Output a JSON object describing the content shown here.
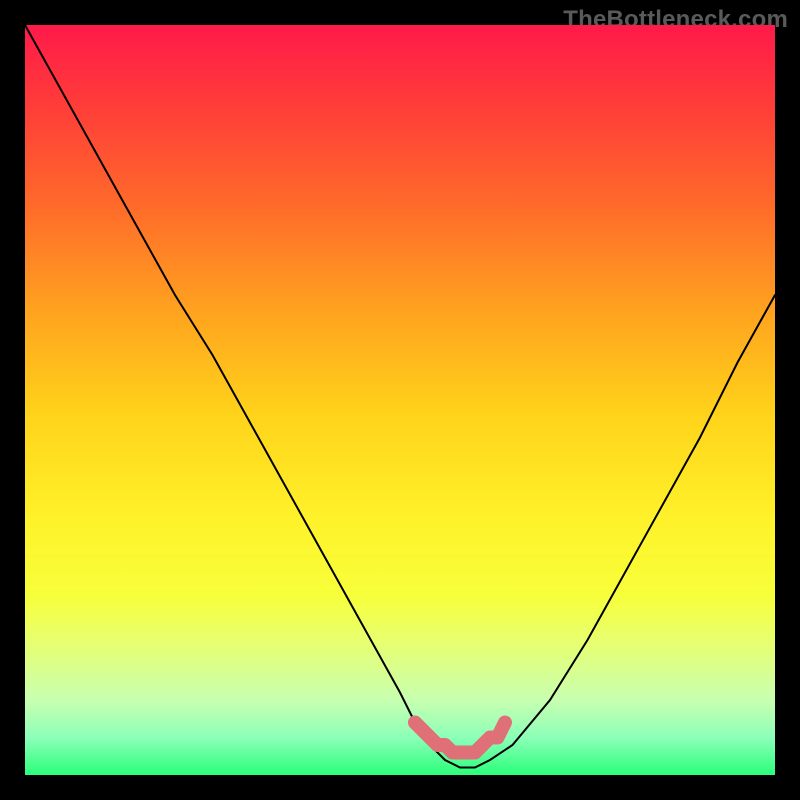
{
  "watermark": "TheBottleneck.com",
  "chart_data": {
    "type": "line",
    "title": "",
    "xlabel": "",
    "ylabel": "",
    "xlim": [
      0,
      100
    ],
    "ylim": [
      0,
      100
    ],
    "series": [
      {
        "name": "bottleneck-curve",
        "x": [
          0,
          5,
          10,
          15,
          20,
          25,
          30,
          35,
          40,
          45,
          50,
          52,
          54,
          56,
          58,
          60,
          62,
          65,
          70,
          75,
          80,
          85,
          90,
          95,
          100
        ],
        "y": [
          100,
          91,
          82,
          73,
          64,
          56,
          47,
          38,
          29,
          20,
          11,
          7,
          4,
          2,
          1,
          1,
          2,
          4,
          10,
          18,
          27,
          36,
          45,
          55,
          64
        ]
      }
    ],
    "annotations": [
      {
        "name": "optimal-marker",
        "kind": "points",
        "color": "#e07078",
        "x": [
          52,
          53,
          54,
          55,
          56,
          57,
          58,
          59,
          60,
          61,
          62,
          63,
          64
        ],
        "y": [
          7,
          6,
          5,
          4,
          4,
          3,
          3,
          3,
          3,
          4,
          5,
          5,
          7
        ]
      }
    ],
    "background": "vertical-gradient red→yellow→green (top to bottom)"
  }
}
